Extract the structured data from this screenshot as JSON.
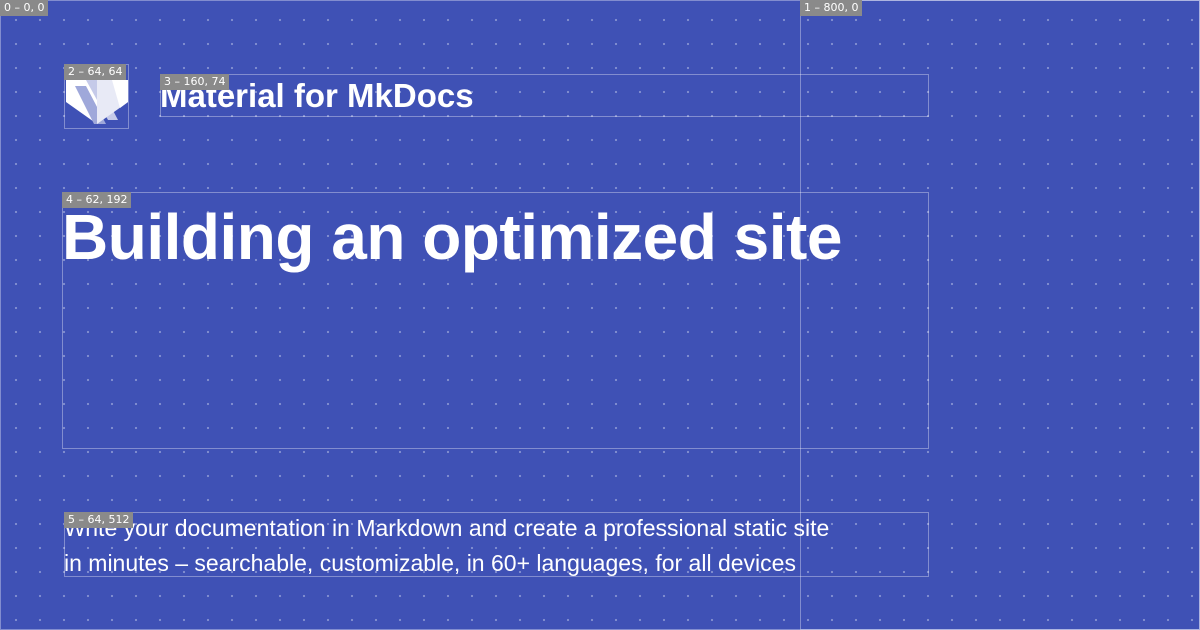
{
  "site": {
    "name": "Material for MkDocs",
    "logo_icon": "material-logo-icon"
  },
  "headline": "Building an optimized site",
  "description": {
    "line1": "Write your documentation in Markdown and create a professional static site",
    "line2": "in minutes – searchable, customizable, in 60+ languages, for all devices"
  },
  "debug_labels": {
    "box0": "0 – 0, 0",
    "box1": "1 – 800, 0",
    "box2": "2 – 64, 64",
    "box3": "3 – 160, 74",
    "box4": "4 – 62, 192",
    "box5": "5 – 64, 512"
  },
  "colors": {
    "background": "#3f51b5",
    "text": "#ffffff",
    "debug_label_bg": "#8a8a8a"
  }
}
